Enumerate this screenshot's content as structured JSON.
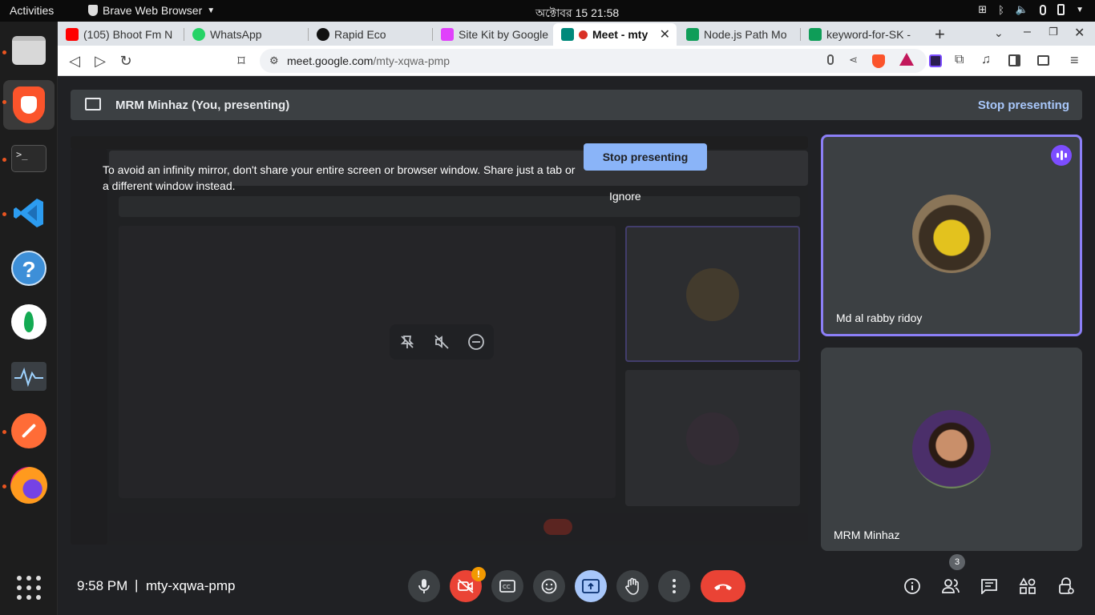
{
  "topbar": {
    "activities": "Activities",
    "app_name": "Brave Web Browser",
    "clock": "অক্টোবর 15  21:58"
  },
  "tabs": [
    {
      "label": "(105) Bhoot Fm N",
      "color": "#ff0000"
    },
    {
      "label": "WhatsApp",
      "color": "#25d366"
    },
    {
      "label": "Rapid Eco",
      "color": "#111111"
    },
    {
      "label": "Site Kit by Google",
      "color": "#e040fb"
    },
    {
      "label": "Meet - mty",
      "color": "#00897b"
    },
    {
      "label": "Node.js Path Mo",
      "color": "#0f9d58"
    },
    {
      "label": "keyword-for-SK -",
      "color": "#0f9d58"
    }
  ],
  "urlbar": {
    "host": "meet.google.com",
    "path": "/mty-xqwa-pmp"
  },
  "presenting": {
    "title": "MRM Minhaz (You, presenting)",
    "stop_label": "Stop presenting"
  },
  "mirror": {
    "warning": "To avoid an infinity mirror, don't share your entire screen or browser window. Share just a tab or a different window instead.",
    "stop_label": "Stop presenting",
    "ignore_label": "Ignore"
  },
  "participants": [
    {
      "name": "Md al rabby ridoy",
      "speaking": true
    },
    {
      "name": "MRM Minhaz",
      "speaking": false
    }
  ],
  "meeting": {
    "time": "9:58 PM",
    "separator": "|",
    "code": "mty-xqwa-pmp",
    "people_count": "3",
    "warning_badge": "!"
  },
  "colors": {
    "accent": "#8c7ff7",
    "end_call": "#ea4335",
    "present_active": "#a8c7fa",
    "link": "#a8c7fa"
  }
}
